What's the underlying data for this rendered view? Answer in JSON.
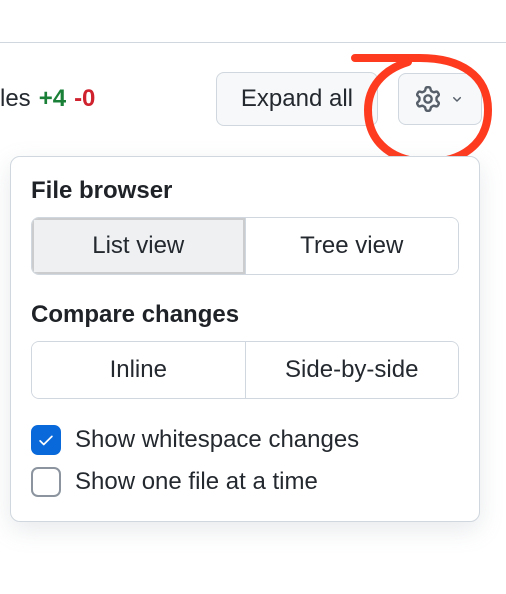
{
  "toolbar": {
    "files_partial_label": "les",
    "additions": "+4",
    "deletions": "-0",
    "expand_all_label": "Expand all"
  },
  "dropdown": {
    "file_browser": {
      "title": "File browser",
      "options": [
        "List view",
        "Tree view"
      ],
      "selected": 0
    },
    "compare_changes": {
      "title": "Compare changes",
      "options": [
        "Inline",
        "Side-by-side"
      ],
      "selected": null
    },
    "checkboxes": [
      {
        "label": "Show whitespace changes",
        "checked": true
      },
      {
        "label": "Show one file at a time",
        "checked": false
      }
    ]
  },
  "annotation": {
    "color": "#ff3b1f"
  }
}
